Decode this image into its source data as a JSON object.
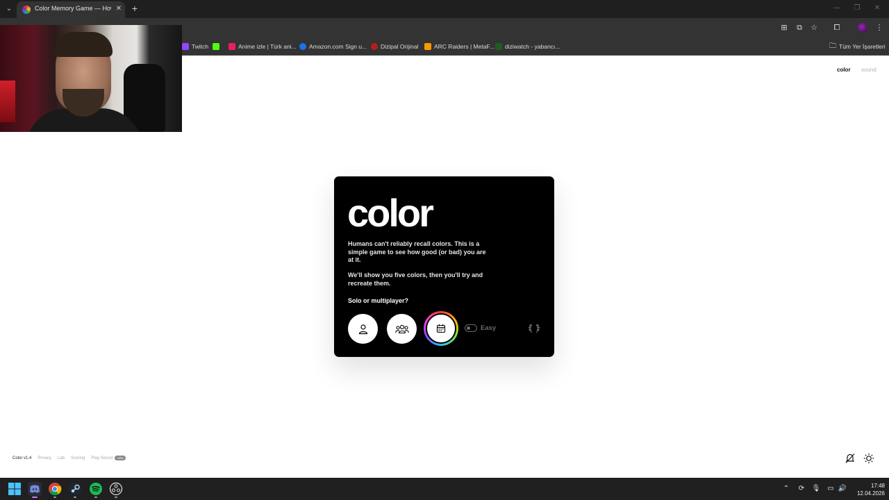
{
  "browser": {
    "tab_title": "Color Memory Game — How W",
    "bookmarks": [
      {
        "label": "Twitch",
        "color": "#9146ff"
      },
      {
        "label": "K",
        "color": "#53fc18"
      },
      {
        "label": "Anime izle | Türk ani...",
        "color": "#e91e63"
      },
      {
        "label": "Amazon.com Sign u...",
        "color": "#1a73e8"
      },
      {
        "label": "Dizipal Orijinal",
        "color": "#b71c1c"
      },
      {
        "label": "ARC Raiders | MetaF...",
        "color": "#ff9800"
      },
      {
        "label": "diziwatch - yabancı...",
        "color": "#1b5e20"
      }
    ],
    "bookmarks_folder": "Tüm Yer İşaretleri"
  },
  "page": {
    "top_links": {
      "color": "color",
      "sound": "sound"
    },
    "card": {
      "title": "color",
      "paragraph1": "Humans can't reliably recall colors. This is a simple game to see how good (or bad) you are at it.",
      "paragraph2": "We'll show you five colors, then you'll try and recreate them.",
      "question": "Solo or multiplayer?",
      "difficulty_label": "Easy"
    },
    "footer": {
      "version": "Color v1.4",
      "links": [
        "Privacy",
        "Lab",
        "Scoring",
        "Play Sound"
      ],
      "badge": "new"
    }
  },
  "taskbar": {
    "time": "17:48",
    "date": "12.04.2026"
  },
  "colors": {
    "brand_black": "#000000",
    "accent_ring": [
      "#ff3b3b",
      "#ffb400",
      "#7ee04a",
      "#27c3ff",
      "#7b4dff",
      "#ff3bd4"
    ]
  }
}
